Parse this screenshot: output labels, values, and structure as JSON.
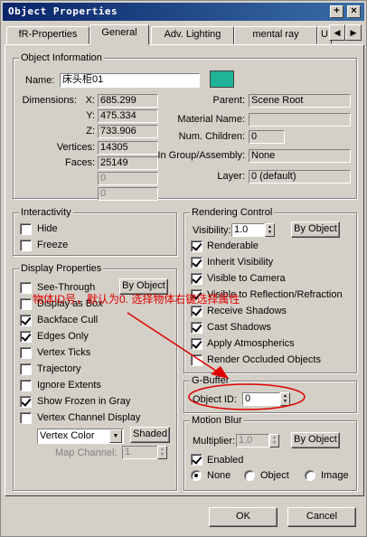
{
  "window": {
    "title": "Object Properties",
    "help_label": "+",
    "close_label": "×"
  },
  "tabs": [
    {
      "label": "fR-Properties"
    },
    {
      "label": "General"
    },
    {
      "label": "Adv. Lighting"
    },
    {
      "label": "mental ray"
    },
    {
      "label": "U"
    }
  ],
  "tab_scroll": {
    "left": "◀",
    "right": "▶"
  },
  "object_info": {
    "title": "Object Information",
    "name_label": "Name:",
    "name_value": "床头柜01",
    "color": "#1fb398",
    "dimensions_label": "Dimensions:",
    "x_label": "X:",
    "x_value": "685.299",
    "y_label": "Y:",
    "y_value": "475.334",
    "z_label": "Z:",
    "z_value": "733.906",
    "vertices_label": "Vertices:",
    "vertices_value": "14305",
    "faces_label": "Faces:",
    "faces_value": "25149",
    "extra1": "0",
    "extra2": "0",
    "parent_label": "Parent:",
    "parent_value": "Scene Root",
    "material_label": "Material Name:",
    "material_value": "",
    "children_label": "Num. Children:",
    "children_value": "0",
    "group_label": "In Group/Assembly:",
    "group_value": "None",
    "layer_label": "Layer:",
    "layer_value": "0 (default)"
  },
  "interactivity": {
    "title": "Interactivity",
    "hide": "Hide",
    "freeze": "Freeze"
  },
  "display": {
    "title": "Display Properties",
    "by_object": "By Object",
    "see_through": "See-Through",
    "display_box": "Display as Box",
    "backface": "Backface Cull",
    "edges": "Edges Only",
    "vertex_ticks": "Vertex Ticks",
    "trajectory": "Trajectory",
    "ignore": "Ignore Extents",
    "frozen_gray": "Show Frozen in Gray",
    "vc_display": "Vertex Channel Display",
    "vc_select": "Vertex Color",
    "shaded": "Shaded",
    "map_channel_label": "Map Channel:",
    "map_channel_value": "1"
  },
  "rendering": {
    "title": "Rendering Control",
    "visibility_label": "Visibility:",
    "visibility_value": "1.0",
    "by_object": "By Object",
    "renderable": "Renderable",
    "inherit": "Inherit Visibility",
    "vis_camera": "Visible to Camera",
    "vis_reflection": "Visible to Reflection/Refraction",
    "receive_shadows": "Receive Shadows",
    "cast_shadows": "Cast Shadows",
    "atmospherics": "Apply Atmospherics",
    "occluded": "Render Occluded Objects"
  },
  "gbuffer": {
    "title": "G-Buffer",
    "object_id_label": "Object ID:",
    "object_id_value": "0"
  },
  "motion_blur": {
    "title": "Motion Blur",
    "multiplier_label": "Multiplier:",
    "multiplier_value": "1.0",
    "by_object": "By Object",
    "enabled": "Enabled",
    "none": "None",
    "object": "Object",
    "image": "Image"
  },
  "footer": {
    "ok": "OK",
    "cancel": "Cancel"
  },
  "annotation": {
    "text": "物体ID号，默认为0. 选择物体右键选择属性",
    "color": "#e00000"
  }
}
